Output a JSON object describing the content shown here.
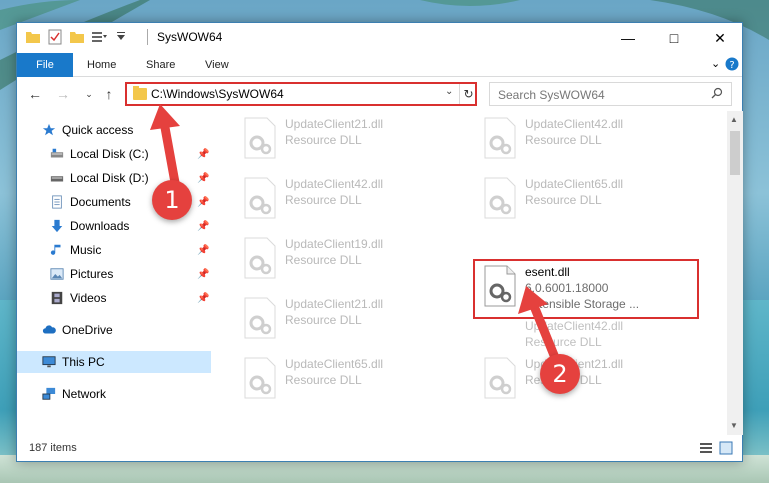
{
  "window": {
    "title": "SysWOW64"
  },
  "ribbon": {
    "tabs": [
      "File",
      "Home",
      "Share",
      "View"
    ]
  },
  "address": {
    "path": "C:\\Windows\\SysWOW64"
  },
  "search": {
    "placeholder": "Search SysWOW64"
  },
  "sidebar": {
    "items": [
      {
        "label": "Quick access",
        "icon": "star-icon"
      },
      {
        "label": "Local Disk (C:)",
        "icon": "drive-icon",
        "pinned": true
      },
      {
        "label": "Local Disk (D:)",
        "icon": "drive-icon",
        "pinned": true
      },
      {
        "label": "Documents",
        "icon": "documents-icon",
        "pinned": true
      },
      {
        "label": "Downloads",
        "icon": "download-arrow-icon",
        "pinned": true
      },
      {
        "label": "Music",
        "icon": "music-note-icon",
        "pinned": true
      },
      {
        "label": "Pictures",
        "icon": "pictures-icon",
        "pinned": true
      },
      {
        "label": "Videos",
        "icon": "video-film-icon",
        "pinned": true
      },
      {
        "label": "OneDrive",
        "icon": "cloud-icon"
      },
      {
        "label": "This PC",
        "icon": "monitor-icon",
        "selected": true
      },
      {
        "label": "Network",
        "icon": "network-icon"
      }
    ]
  },
  "files": [
    {
      "name": "UpdateClient21.dll",
      "desc": "Resource DLL",
      "faded": true
    },
    {
      "name": "UpdateClient42.dll",
      "desc": "Resource DLL",
      "faded": true
    },
    {
      "name": "UpdateClient42.dll",
      "desc": "Resource DLL",
      "faded": true
    },
    {
      "name": "UpdateClient65.dll",
      "desc": "Resource DLL",
      "faded": true
    },
    {
      "name": "UpdateClient19.dll",
      "desc": "Resource DLL",
      "faded": true
    },
    {
      "name": "esent.dll",
      "desc": "6.0.6001.18000",
      "desc2": "Extensible Storage ...",
      "highlight": true
    },
    {
      "name": "UpdateClient21.dll",
      "desc": "Resource DLL",
      "faded": true
    },
    {
      "name": "UpdateClient42.dll",
      "desc": "Resource DLL",
      "faded": true
    },
    {
      "name": "UpdateClient65.dll",
      "desc": "Resource DLL",
      "faded": true
    },
    {
      "name": "UpdateClient21.dll",
      "desc": "Resource DLL",
      "faded": true
    }
  ],
  "status": {
    "item_count": "187 items"
  },
  "annotations": {
    "step1": "1",
    "step2": "2"
  },
  "colors": {
    "accent": "#1979ca",
    "highlight_red": "#d9302f",
    "callout_red": "#e5413e",
    "selected_bg": "#cce8ff"
  }
}
